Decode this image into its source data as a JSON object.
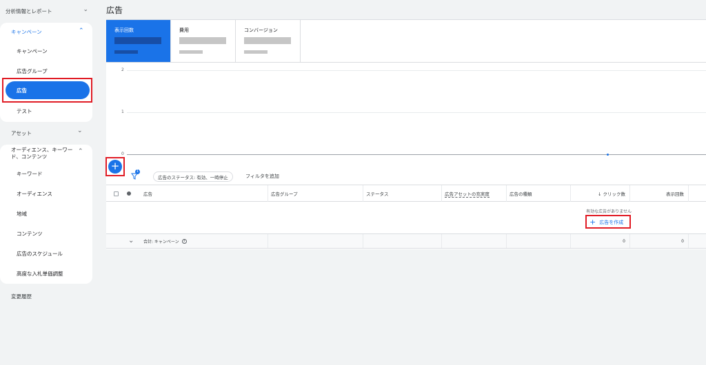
{
  "sidebar": {
    "analytics_label": "分析情報とレポート",
    "campaign_section": {
      "title": "キャンペーン",
      "items": [
        "キャンペーン",
        "広告グループ",
        "広告",
        "テスト"
      ]
    },
    "assets_label": "アセット",
    "audience_section": {
      "title": "オーディエンス、キーワード、コンテンツ",
      "items": [
        "キーワード",
        "オーディエンス",
        "地域",
        "コンテンツ",
        "広告のスケジュール",
        "高度な入札単価調整"
      ]
    },
    "history_label": "変更履歴"
  },
  "page": {
    "title": "広告"
  },
  "metrics": [
    {
      "label": "表示回数",
      "active": true
    },
    {
      "label": "費用",
      "active": false
    },
    {
      "label": "コンバージョン",
      "active": false
    }
  ],
  "chart_data": {
    "type": "line",
    "y_ticks": [
      "2",
      "1",
      "0"
    ],
    "ylim": [
      0,
      2
    ],
    "series": [
      {
        "values": [
          0
        ]
      }
    ]
  },
  "toolbar": {
    "add_button": "+",
    "filter_badge": "1",
    "status_chip": "広告のステータス: 有効、一時停止",
    "add_filter": "フィルタを追加"
  },
  "table": {
    "headers": {
      "ad": "広告",
      "ad_group": "広告グループ",
      "status": "ステータス",
      "asset_strength": "広告アセットの充実度",
      "ad_type": "広告の種類",
      "clicks": "↓ クリック数",
      "impressions": "表示回数"
    },
    "empty_message": "有効な広告がありません",
    "create_label": "広告を作成",
    "total": {
      "label": "合計: キャンペーン",
      "clicks": "0",
      "impressions": "0"
    }
  },
  "colors": {
    "accent": "#1a73e8",
    "highlight": "#e01b24"
  }
}
